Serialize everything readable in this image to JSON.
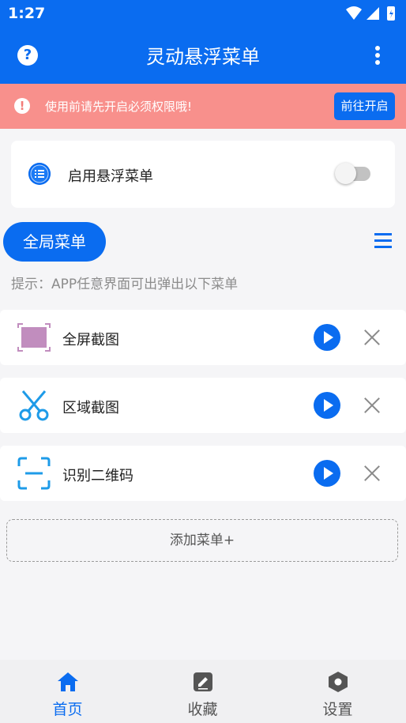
{
  "status": {
    "time": "1:27"
  },
  "app_bar": {
    "title": "灵动悬浮菜单"
  },
  "banner": {
    "text": "使用前请先开启必须权限哦!",
    "button": "前往开启"
  },
  "enable_card": {
    "label": "启用悬浮菜单",
    "enabled": false
  },
  "section": {
    "tab_label": "全局菜单",
    "hint": "提示：APP任意界面可出弹出以下菜单"
  },
  "menu_items": [
    {
      "label": "全屏截图",
      "icon": "fullscreen-screenshot-icon"
    },
    {
      "label": "区域截图",
      "icon": "scissors-icon"
    },
    {
      "label": "识别二维码",
      "icon": "qr-scan-icon"
    }
  ],
  "add_menu": {
    "label": "添加菜单+"
  },
  "bottom_nav": [
    {
      "label": "首页",
      "icon": "home-icon",
      "active": true
    },
    {
      "label": "收藏",
      "icon": "edit-note-icon",
      "active": false
    },
    {
      "label": "设置",
      "icon": "settings-hexagon-icon",
      "active": false
    }
  ],
  "colors": {
    "primary": "#0a6cf0",
    "banner": "#f8908c",
    "background": "#f5f5f7"
  }
}
